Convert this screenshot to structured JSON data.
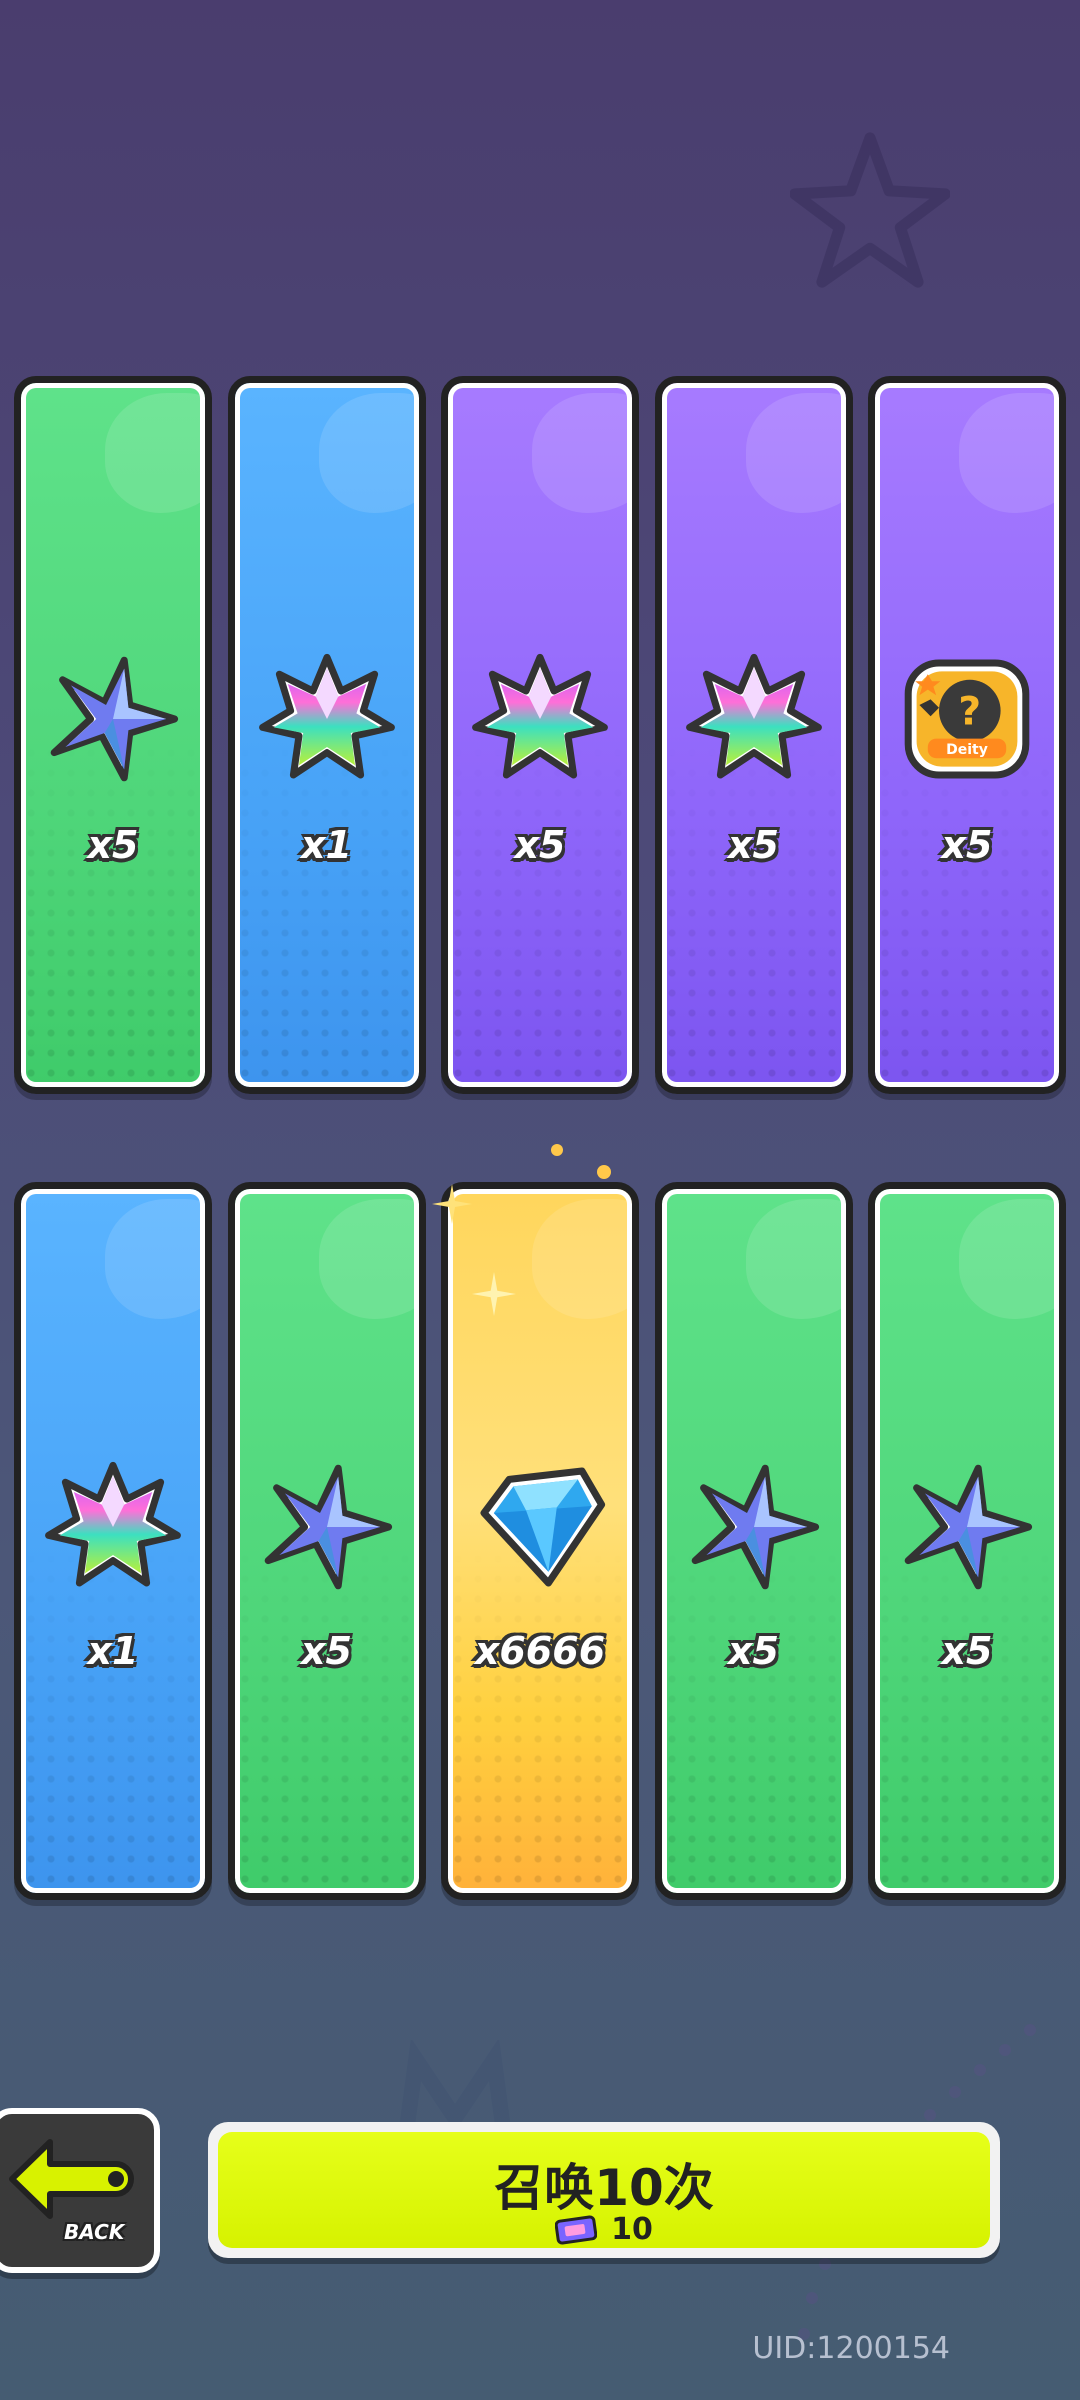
{
  "rewards_row1": [
    {
      "rarity": "green",
      "icon": "blue-star-crystal-icon",
      "qty": "x5"
    },
    {
      "rarity": "blue",
      "icon": "rainbow-leaf-crystal-icon",
      "qty": "x1"
    },
    {
      "rarity": "purple",
      "icon": "rainbow-leaf-crystal-icon",
      "qty": "x5"
    },
    {
      "rarity": "purple",
      "icon": "rainbow-leaf-crystal-icon",
      "qty": "x5"
    },
    {
      "rarity": "purple",
      "icon": "mystery-puzzle-coin-icon",
      "qty": "x5",
      "icon_text": "Deity"
    }
  ],
  "rewards_row2": [
    {
      "rarity": "blue",
      "icon": "rainbow-leaf-crystal-icon",
      "qty": "x1"
    },
    {
      "rarity": "green",
      "icon": "blue-star-crystal-icon",
      "qty": "x5"
    },
    {
      "rarity": "gold",
      "icon": "diamond-gem-icon",
      "qty": "x6666"
    },
    {
      "rarity": "green",
      "icon": "blue-star-crystal-icon",
      "qty": "x5"
    },
    {
      "rarity": "green",
      "icon": "blue-star-crystal-icon",
      "qty": "x5"
    }
  ],
  "back_button": {
    "label": "BACK",
    "icon": "back-arrow-icon"
  },
  "summon_button": {
    "title": "召唤10次",
    "cost": "10",
    "cost_icon": "summon-ticket-icon"
  },
  "uid": "UID:1200154",
  "colors": {
    "green": "#4fd67a",
    "blue": "#48a3f7",
    "purple": "#8f66fa",
    "gold": "#ffd65c",
    "summon": "#e0fa0a"
  }
}
